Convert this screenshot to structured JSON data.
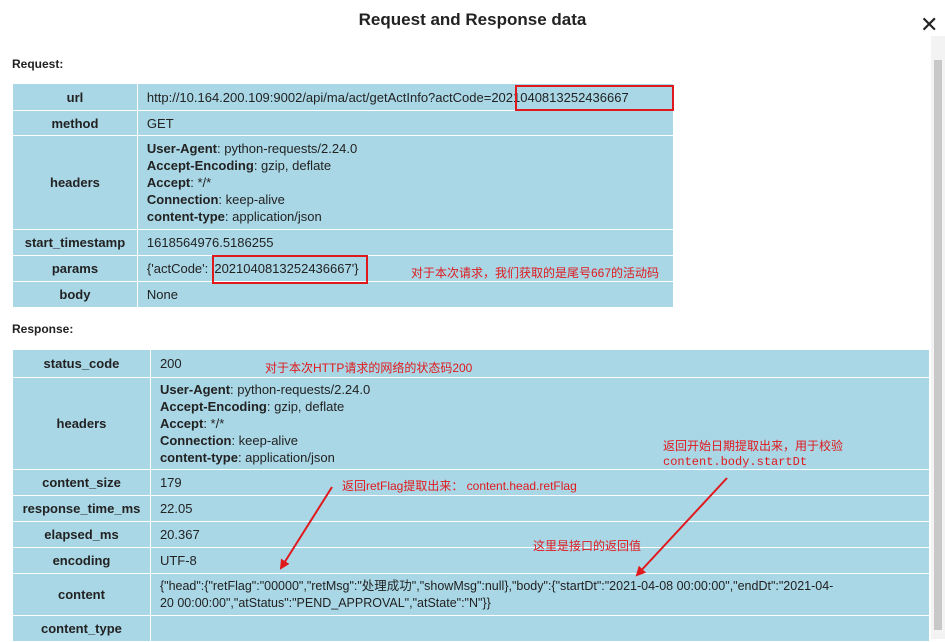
{
  "dialog": {
    "title": "Request and Response data",
    "close_label": "✕"
  },
  "request": {
    "section_label": "Request:",
    "url": {
      "key": "url",
      "value_prefix": "http://10.164.200.109:9002/api/ma/act/getActInfo?actCode=",
      "value_code": "2021040813252436667"
    },
    "method": {
      "key": "method",
      "value": "GET"
    },
    "headers": {
      "key": "headers",
      "lines": [
        {
          "name": "User-Agent",
          "value": ": python-requests/2.24.0"
        },
        {
          "name": "Accept-Encoding",
          "value": ": gzip, deflate"
        },
        {
          "name": "Accept",
          "value": ": */*"
        },
        {
          "name": "Connection",
          "value": ": keep-alive"
        },
        {
          "name": "content-type",
          "value": ": application/json"
        }
      ]
    },
    "start_timestamp": {
      "key": "start_timestamp",
      "value": "1618564976.5186255"
    },
    "params": {
      "key": "params",
      "value_prefix": "{'actCode': ",
      "value_code": "'2021040813252436667'}"
    },
    "body": {
      "key": "body",
      "value": "None"
    }
  },
  "response": {
    "section_label": "Response:",
    "status_code": {
      "key": "status_code",
      "value": "200"
    },
    "headers": {
      "key": "headers",
      "lines": [
        {
          "name": "User-Agent",
          "value": ": python-requests/2.24.0"
        },
        {
          "name": "Accept-Encoding",
          "value": ": gzip, deflate"
        },
        {
          "name": "Accept",
          "value": ": */*"
        },
        {
          "name": "Connection",
          "value": ": keep-alive"
        },
        {
          "name": "content-type",
          "value": ": application/json"
        }
      ]
    },
    "content_size": {
      "key": "content_size",
      "value": "179"
    },
    "response_time_ms": {
      "key": "response_time_ms",
      "value": "22.05"
    },
    "elapsed_ms": {
      "key": "elapsed_ms",
      "value": "20.367"
    },
    "encoding": {
      "key": "encoding",
      "value": "UTF-8"
    },
    "content": {
      "key": "content",
      "line1": "{\"head\":{\"retFlag\":\"00000\",\"retMsg\":\"处理成功\",\"showMsg\":null},\"body\":{\"startDt\":\"2021-04-08 00:00:00\",\"endDt\":\"2021-04-",
      "line2": "20 00:00:00\",\"atStatus\":\"PEND_APPROVAL\",\"atState\":\"N\"}}"
    },
    "content_type": {
      "key": "content_type",
      "value": ""
    }
  },
  "annotations": {
    "params_note": "对于本次请求，我们获取的是尾号667的活动码",
    "status_note": "对于本次HTTP请求的网络的状态码200",
    "startdt_note_line1": "返回开始日期提取出来，用于校验",
    "startdt_note_line2": "content.body.startDt",
    "retflag_note": "返回retFlag提取出来：  content.head.retFlag",
    "content_note": "这里是接口的返回值"
  },
  "colors": {
    "cell_bg": "#a9d7e6",
    "annotation_red": "#e0191d"
  }
}
